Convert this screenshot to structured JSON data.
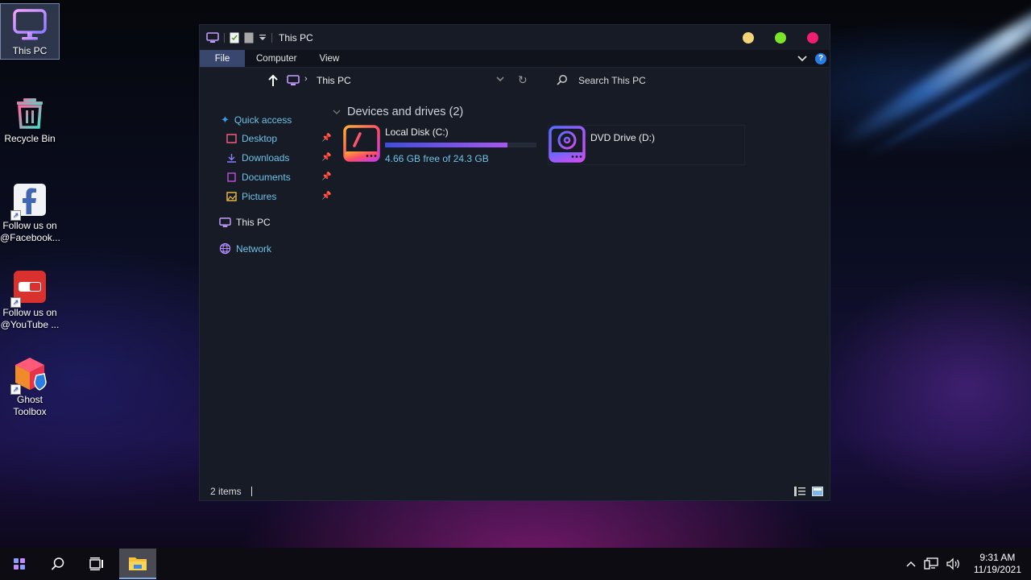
{
  "desktop": {
    "icons": [
      {
        "label": "This PC",
        "icon": "monitor-icon"
      },
      {
        "label": "Recycle Bin",
        "icon": "recycle-bin-icon"
      },
      {
        "label": "Follow us on @Facebook...",
        "icon": "facebook-icon"
      },
      {
        "label": "Follow us on @YouTube ...",
        "icon": "youtube-icon"
      },
      {
        "label": "Ghost Toolbox",
        "icon": "ghost-toolbox-icon"
      }
    ]
  },
  "window": {
    "title": "This PC",
    "controls": {
      "minimize_color": "#f4d27a",
      "maximize_color": "#7be52b",
      "close_color": "#f01e6e"
    },
    "ribbon_tabs": [
      "File",
      "Computer",
      "View"
    ],
    "help_label": "?",
    "address": {
      "path": "This PC",
      "search_placeholder": "Search This PC"
    },
    "nav": {
      "quick_access": "Quick access",
      "pinned": [
        "Desktop",
        "Downloads",
        "Documents",
        "Pictures"
      ],
      "this_pc": "This PC",
      "network": "Network"
    },
    "group_header": "Devices and drives (2)",
    "drives": [
      {
        "name": "Local Disk (C:)",
        "free_text": "4.66 GB free of 24.3 GB",
        "free_gb": 4.66,
        "total_gb": 24.3
      },
      {
        "name": "DVD Drive (D:)"
      }
    ],
    "status": {
      "items": "2 items"
    }
  },
  "taskbar": {
    "time": "9:31 AM",
    "date": "11/19/2021"
  },
  "colors": {
    "accent": "#39466e",
    "link_blue": "#6fc3e8",
    "window_bg": "#171b25"
  }
}
